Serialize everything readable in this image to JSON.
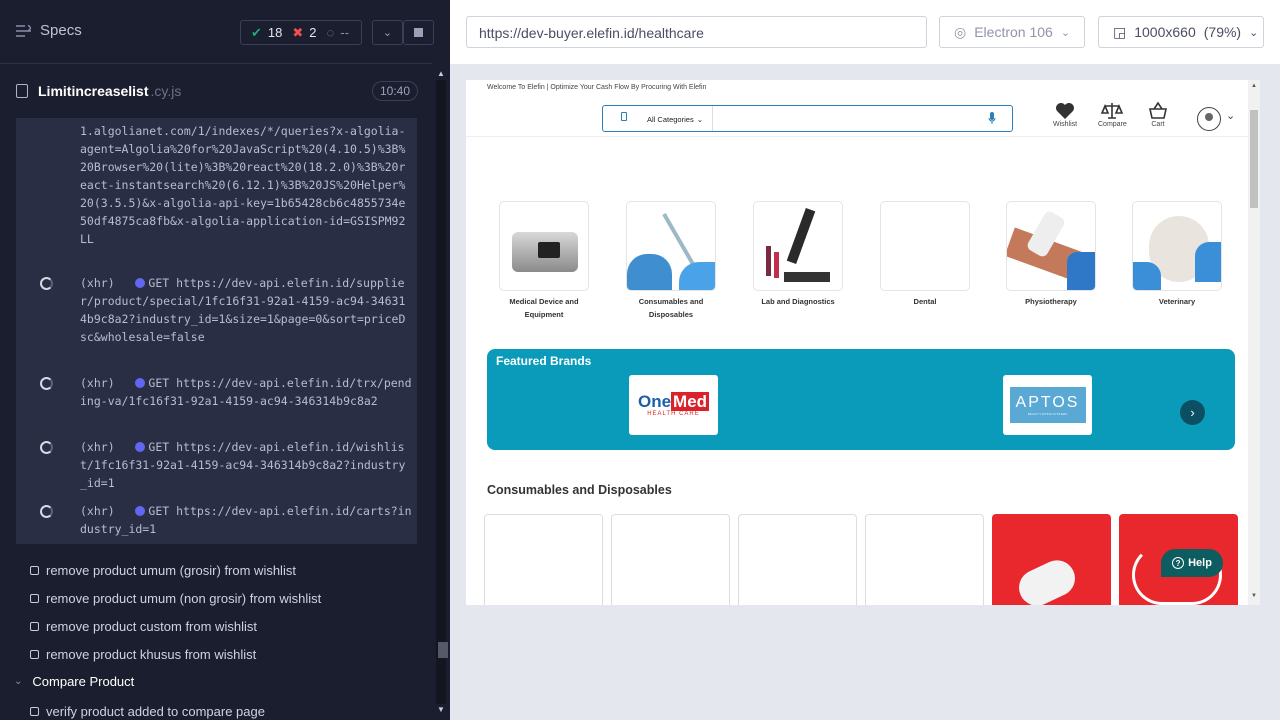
{
  "runner": {
    "title": "Specs",
    "stats": {
      "passed": "18",
      "failed": "2",
      "pending": "--"
    },
    "file": {
      "name": "Limitincreaselist",
      "ext": ".cy.js",
      "duration": "10:40"
    }
  },
  "command_log": {
    "first_url": "1.algolianet.com/1/indexes/*/queries?x-algolia-agent=Algolia%20for%20JavaScript%20(4.10.5)%3B%20Browser%20(lite)%3B%20react%20(18.2.0)%3B%20react-instantsearch%20(6.12.1)%3B%20JS%20Helper%20(3.5.5)&x-algolia-api-key=1b65428cb6c4855734e50df4875ca8fb&x-algolia-application-id=GSISPM92LL",
    "xhr": [
      {
        "type": "(xhr)",
        "method": "GET",
        "url": "https://dev-api.elefin.id/supplier/product/special/1fc16f31-92a1-4159-ac94-346314b9c8a2?industry_id=1&size=1&page=0&sort=priceDsc&wholesale=false"
      },
      {
        "type": "(xhr)",
        "method": "GET",
        "url": "https://dev-api.elefin.id/trx/pending-va/1fc16f31-92a1-4159-ac94-346314b9c8a2"
      },
      {
        "type": "(xhr)",
        "method": "GET",
        "url": "https://dev-api.elefin.id/wishlist/1fc16f31-92a1-4159-ac94-346314b9c8a2?industry_id=1"
      },
      {
        "type": "(xhr)",
        "method": "GET",
        "url": "https://dev-api.elefin.id/carts?industry_id=1"
      }
    ]
  },
  "tests": [
    "remove product umum (grosir) from wishlist",
    "remove product umum (non grosir) from wishlist",
    "remove product custom from wishlist",
    "remove product khusus from wishlist"
  ],
  "suite": {
    "name": "Compare Product",
    "first_test": "verify product added to compare page"
  },
  "browser_bar": {
    "url": "https://dev-buyer.elefin.id/healthcare",
    "browser": "Electron 106",
    "viewport": "1000x660",
    "zoom": "(79%)"
  },
  "app": {
    "welcome": "Welcome To Elefin | Optimize Your Cash Flow By Procuring With Elefin",
    "search": {
      "category": "All Categories"
    },
    "header": {
      "wishlist": "Wishlist",
      "compare": "Compare",
      "cart": "Cart"
    },
    "categories": [
      {
        "label": "Medical Device and Equipment"
      },
      {
        "label": "Consumables and Disposables"
      },
      {
        "label": "Lab and Diagnostics"
      },
      {
        "label": "Dental"
      },
      {
        "label": "Physiotherapy"
      },
      {
        "label": "Veterinary"
      }
    ],
    "featured": {
      "title": "Featured Brands",
      "brand1": {
        "name_a": "One",
        "name_b": "Med",
        "sub": "HEALTH CARE"
      },
      "brand2": {
        "name": "APTOS",
        "sub": "BEAUTY LIFTING SYSTEMS"
      }
    },
    "section_title": "Consumables and Disposables",
    "help": "Help"
  }
}
